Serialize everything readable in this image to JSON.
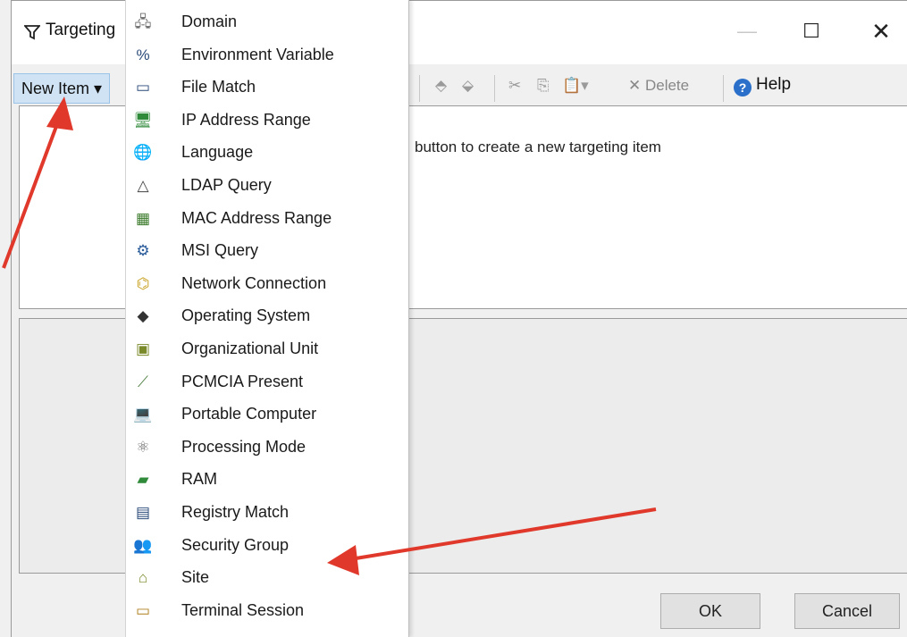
{
  "window": {
    "title": "Targeting",
    "minimize_glyph": "—",
    "maximize_glyph": "☐",
    "close_glyph": "✕"
  },
  "toolbar": {
    "new_item_label": "New Item ▾",
    "move_up_glyph": "⬘",
    "move_down_glyph": "⬙",
    "cut_glyph": "✂",
    "copy_glyph": "⎘",
    "paste_glyph": "📋▾",
    "delete_label": "✕ Delete",
    "help_label": "Help"
  },
  "main": {
    "hint": "button to create a new targeting item"
  },
  "buttons": {
    "ok": "OK",
    "cancel": "Cancel"
  },
  "menu": {
    "items": [
      {
        "label": "Domain",
        "icon": "domain-icon",
        "glyph": "🖧"
      },
      {
        "label": "Environment Variable",
        "icon": "environment-variable-icon",
        "glyph": "%"
      },
      {
        "label": "File Match",
        "icon": "file-match-icon",
        "glyph": "▭"
      },
      {
        "label": "IP Address Range",
        "icon": "ip-address-range-icon",
        "glyph": "🖥"
      },
      {
        "label": "Language",
        "icon": "language-icon",
        "glyph": "🌐"
      },
      {
        "label": "LDAP Query",
        "icon": "ldap-query-icon",
        "glyph": "△"
      },
      {
        "label": "MAC Address Range",
        "icon": "mac-address-range-icon",
        "glyph": "▦"
      },
      {
        "label": "MSI Query",
        "icon": "msi-query-icon",
        "glyph": "⚙"
      },
      {
        "label": "Network Connection",
        "icon": "network-connection-icon",
        "glyph": "⌬"
      },
      {
        "label": "Operating System",
        "icon": "operating-system-icon",
        "glyph": "◆"
      },
      {
        "label": "Organizational Unit",
        "icon": "organizational-unit-icon",
        "glyph": "▣"
      },
      {
        "label": "PCMCIA Present",
        "icon": "pcmcia-present-icon",
        "glyph": "⟋"
      },
      {
        "label": "Portable Computer",
        "icon": "portable-computer-icon",
        "glyph": "💻"
      },
      {
        "label": "Processing Mode",
        "icon": "processing-mode-icon",
        "glyph": "⚛"
      },
      {
        "label": "RAM",
        "icon": "ram-icon",
        "glyph": "▰"
      },
      {
        "label": "Registry Match",
        "icon": "registry-match-icon",
        "glyph": "▤"
      },
      {
        "label": "Security Group",
        "icon": "security-group-icon",
        "glyph": "👥"
      },
      {
        "label": "Site",
        "icon": "site-icon",
        "glyph": "⌂"
      },
      {
        "label": "Terminal Session",
        "icon": "terminal-session-icon",
        "glyph": "▭"
      }
    ]
  },
  "colors": {
    "annotation_arrow": "#e0392b",
    "new_item_highlight": "#cfe3f5",
    "help_blue": "#2a6fc9"
  }
}
